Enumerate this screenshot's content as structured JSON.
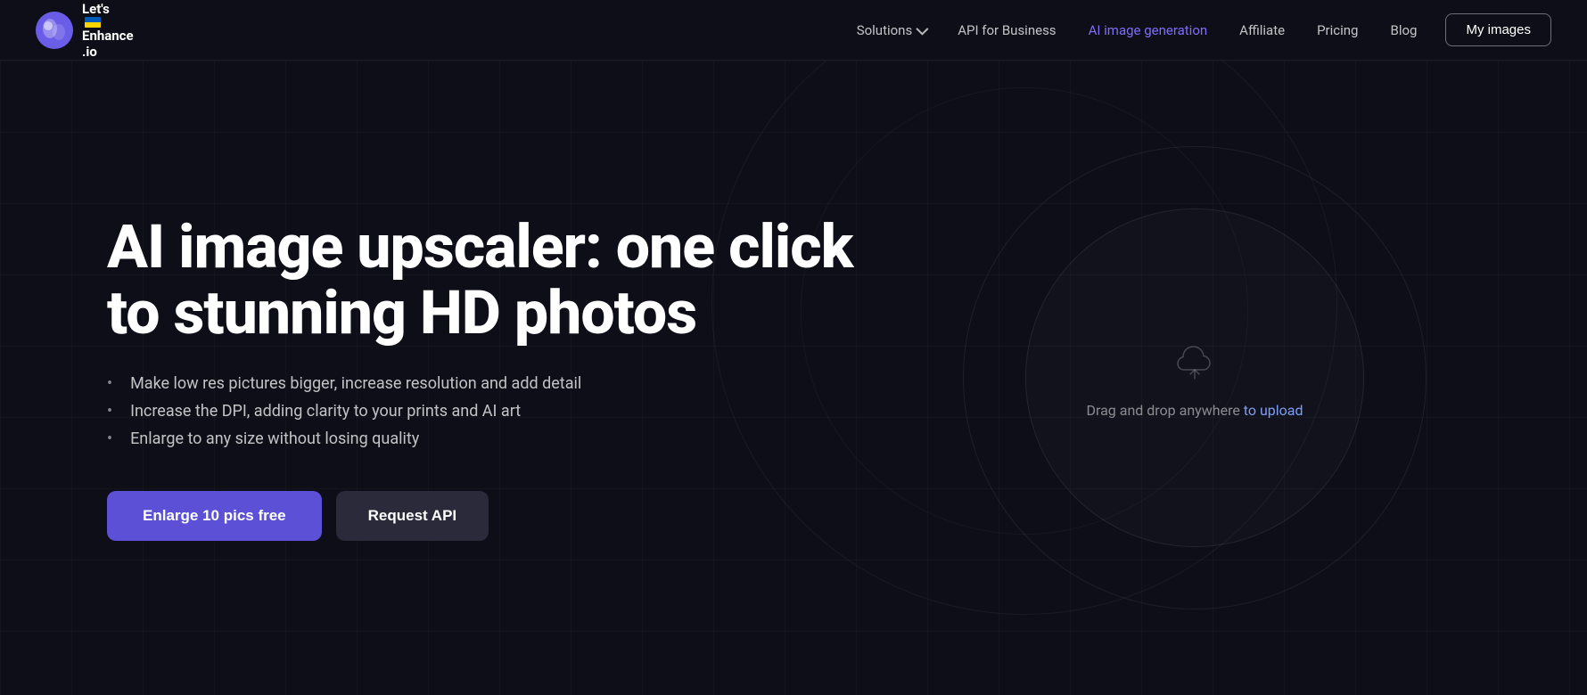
{
  "logo": {
    "text_line1": "Let's",
    "text_line2": "Enhance",
    "text_line3": ".io"
  },
  "nav": {
    "solutions_label": "Solutions",
    "api_label": "API for Business",
    "ai_label": "AI image generation",
    "affiliate_label": "Affiliate",
    "pricing_label": "Pricing",
    "blog_label": "Blog",
    "my_images_label": "My images"
  },
  "hero": {
    "title": "AI image upscaler: one click to stunning HD photos",
    "bullets": [
      "Make low res pictures bigger, increase resolution and add detail",
      "Increase the DPI, adding clarity to your prints and AI art",
      "Enlarge to any size without losing quality"
    ],
    "cta_primary": "Enlarge 10 pics free",
    "cta_secondary": "Request API",
    "upload_text_before": "Drag and drop anywhere ",
    "upload_link_text": "to upload"
  },
  "colors": {
    "primary_button": "#5b50d6",
    "secondary_button": "#2a2a3a",
    "nav_active": "#7c6ef7",
    "upload_link": "#7c9ef7",
    "background": "#0e0e18"
  }
}
